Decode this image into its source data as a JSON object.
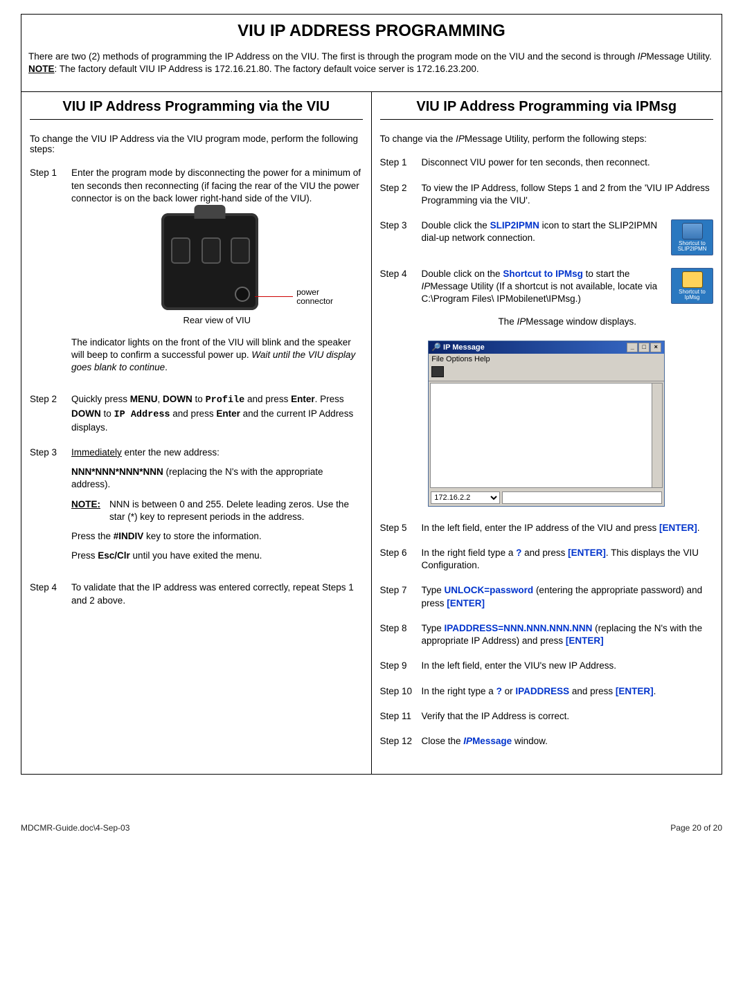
{
  "title": "VIU IP ADDRESS PROGRAMMING",
  "intro_a": "There are two (2) methods of programming the IP Address on the VIU.  The first is through the program mode on the VIU and the second is through ",
  "intro_b": "IP",
  "intro_c": "Message Utility.   ",
  "intro_note_label": "NOTE",
  "intro_note_text": ":  The factory default VIU IP Address is 172.16.21.80.  The factory default voice server is 172.16.23.200.",
  "left": {
    "heading": "VIU IP Address Programming via the VIU",
    "lead": "To change the VIU IP Address via the VIU program mode, perform the following steps:",
    "step1_label": "Step 1",
    "step1_text": "Enter the program mode by disconnecting the power for a minimum of ten seconds then reconnecting (if facing the rear of the VIU the power connector is on the back lower right-hand side of the VIU).",
    "fig_lead_a": "power",
    "fig_lead_b": "connector",
    "fig_caption": "Rear view of VIU",
    "step1_after_a": "The indicator lights on the front of the VIU will blink and the speaker will beep to confirm a successful power up.  ",
    "step1_after_b": "Wait until the VIU display goes blank to continue",
    "step1_after_c": ".",
    "step2_label": "Step 2",
    "step2_a": "Quickly press ",
    "step2_b": "MENU",
    "step2_c": ", ",
    "step2_d": "DOWN",
    "step2_e": " to ",
    "step2_f": "Profile",
    "step2_g": " and press ",
    "step2_h": "Enter",
    "step2_i": ".  Press ",
    "step2_j": "DOWN",
    "step2_k": " to ",
    "step2_l": "IP Address",
    "step2_m": " and press ",
    "step2_n": "Enter",
    "step2_o": " and the current IP Address displays.",
    "step3_label": "Step 3",
    "step3_a": "Immediately",
    "step3_b": " enter the new address:",
    "step3_c": "NNN*NNN*NNN*NNN",
    "step3_d": " (replacing the N's with the appropriate address).",
    "note_label": "NOTE:",
    "note_text": "NNN is between 0 and 255.  Delete leading zeros.  Use the star (*) key to represent periods in the address.",
    "step3_e": "Press the ",
    "step3_f": "#INDIV",
    "step3_g": " key to store the information.",
    "step3_h": "Press ",
    "step3_i": "Esc/Clr",
    "step3_j": " until you have exited the menu.",
    "step4_label": "Step 4",
    "step4_text": "To validate that the IP address was entered correctly, repeat Steps 1 and 2 above."
  },
  "right": {
    "heading": "VIU IP Address Programming via IPMsg",
    "lead_a": "To change via the ",
    "lead_b": "IP",
    "lead_c": "Message Utility, perform the following steps:",
    "s1l": "Step 1",
    "s1t": "Disconnect VIU power for ten seconds, then reconnect.",
    "s2l": "Step 2",
    "s2t": "To view the IP Address, follow Steps 1 and 2 from the 'VIU IP Address Programming via the VIU'.",
    "s3l": "Step 3",
    "s3a": "Double click the ",
    "s3b": "SLIP2IPMN",
    "s3c": " icon to start the SLIP2IPMN dial-up network connection.",
    "icon1": "Shortcut to SLIP2IPMN",
    "s4l": "Step 4",
    "s4a": "Double click on the ",
    "s4b": "Shortcut to IPMsg",
    "s4c": " to start the ",
    "s4d": "IP",
    "s4e": "Message Utility (If a shortcut is not available, locate via C:\\Program Files\\ IPMobilenet\\IPMsg.)",
    "icon2": "Shortcut to IpMsg",
    "s4f": "The ",
    "s4g": "IP",
    "s4h": "Message window displays.",
    "win_title": "IP Message",
    "win_menu": "File   Options   Help",
    "win_ip": "172.16.2.2",
    "s5l": "Step 5",
    "s5a": "In the left field, enter the IP address of the VIU and press ",
    "s5b": "[ENTER]",
    "s5c": ".",
    "s6l": "Step 6",
    "s6a": "In the right field type a ",
    "s6b": "?",
    "s6c": " and press ",
    "s6d": "[ENTER]",
    "s6e": ".  This displays the VIU Configuration.",
    "s7l": "Step 7",
    "s7a": "Type ",
    "s7b": "UNLOCK=password",
    "s7c": " (entering the appropriate password) and press ",
    "s7d": "[ENTER]",
    "s8l": "Step 8",
    "s8a": "Type ",
    "s8b": "IPADDRESS=NNN.NNN.NNN.NNN",
    "s8c": " (replacing the N's with the appropriate IP Address) and press ",
    "s8d": "[ENTER]",
    "s9l": "Step 9",
    "s9t": "In the left field, enter the VIU's new IP Address.",
    "s10l": "Step 10",
    "s10a": "In the right type a ",
    "s10b": "?",
    "s10c": " or ",
    "s10d": "IPADDRESS",
    "s10e": " and press ",
    "s10f": "[ENTER]",
    "s10g": ".",
    "s11l": "Step 11",
    "s11t": "Verify that the IP Address is correct.",
    "s12l": "Step 12",
    "s12a": "Close the ",
    "s12b": "IP",
    "s12c": "Message",
    "s12d": " window."
  },
  "footer_left": "MDCMR-Guide.doc\\4-Sep-03",
  "footer_right": "Page 20 of 20"
}
